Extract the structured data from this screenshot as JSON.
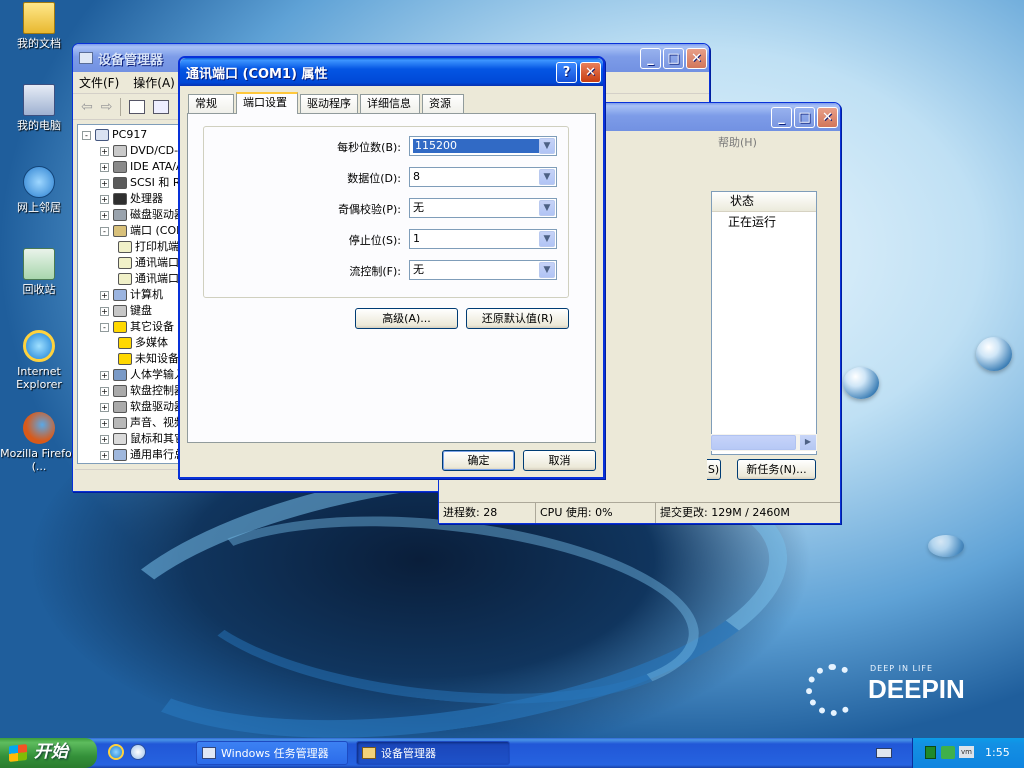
{
  "desktop": {
    "icons": [
      {
        "label": "我的文档",
        "icon": "my-documents-icon"
      },
      {
        "label": "我的电脑",
        "icon": "my-computer-icon"
      },
      {
        "label": "网上邻居",
        "icon": "network-places-icon"
      },
      {
        "label": "回收站",
        "icon": "recycle-bin-icon"
      },
      {
        "label": "Internet Explorer",
        "icon": "internet-explorer-icon"
      },
      {
        "label": "Mozilla Firefox (...",
        "icon": "firefox-icon"
      }
    ],
    "brand": {
      "tagline": "DEEP IN LIFE",
      "name": "DEEPIN"
    }
  },
  "device_manager": {
    "title": "设备管理器",
    "menu": [
      "文件(F)",
      "操作(A)"
    ],
    "tree": {
      "root": "PC917",
      "items": [
        {
          "label": "DVD/CD-ROM 驱动器",
          "expand": "+"
        },
        {
          "label": "IDE ATA/ATAPI 控制器",
          "expand": "+"
        },
        {
          "label": "SCSI 和 RAID 控制器",
          "expand": "+"
        },
        {
          "label": "处理器",
          "expand": "+"
        },
        {
          "label": "磁盘驱动器",
          "expand": "+"
        },
        {
          "label": "端口 (COM 和 LPT)",
          "expand": "-"
        },
        {
          "label": "打印机端口",
          "expand": "",
          "child": true
        },
        {
          "label": "通讯端口",
          "expand": "",
          "child": true
        },
        {
          "label": "通讯端口",
          "expand": "",
          "child": true
        },
        {
          "label": "计算机",
          "expand": "+"
        },
        {
          "label": "键盘",
          "expand": "+"
        },
        {
          "label": "其它设备",
          "expand": "-"
        },
        {
          "label": "多媒体",
          "expand": "",
          "child": true
        },
        {
          "label": "未知设备",
          "expand": "",
          "child": true
        },
        {
          "label": "人体学输入设备",
          "expand": "+"
        },
        {
          "label": "软盘控制器",
          "expand": "+"
        },
        {
          "label": "软盘驱动器",
          "expand": "+"
        },
        {
          "label": "声音、视频和游戏控制器",
          "expand": "+"
        },
        {
          "label": "鼠标和其它指针设备",
          "expand": "+"
        },
        {
          "label": "通用串行总线控制器",
          "expand": "+"
        }
      ]
    }
  },
  "task_manager": {
    "title": "Windows 任务管理器",
    "menu_help": "帮助(H)",
    "column_status": "状态",
    "row_status": "正在运行",
    "buttons": {
      "switch_partial": "S)",
      "new_task": "新任务(N)..."
    },
    "status_bar": {
      "processes": "进程数: 28",
      "cpu": "CPU 使用: 0%",
      "commit": "提交更改: 129M / 2460M"
    }
  },
  "dialog": {
    "title": "通讯端口 (COM1) 属性",
    "tabs": [
      "常规",
      "端口设置",
      "驱动程序",
      "详细信息",
      "资源"
    ],
    "selected_tab": 1,
    "fields": [
      {
        "label": "每秒位数(B):",
        "value": "115200",
        "highlighted": true
      },
      {
        "label": "数据位(D):",
        "value": "8"
      },
      {
        "label": "奇偶校验(P):",
        "value": "无"
      },
      {
        "label": "停止位(S):",
        "value": "1"
      },
      {
        "label": "流控制(F):",
        "value": "无"
      }
    ],
    "advanced_button": "高级(A)...",
    "restore_button": "还原默认值(R)",
    "ok_button": "确定",
    "cancel_button": "取消"
  },
  "taskbar": {
    "start_label": "开始",
    "tasks": [
      "Windows 任务管理器",
      "设备管理器"
    ],
    "clock": "1:55"
  },
  "colors": {
    "xp_blue": "#0054e3",
    "start_green": "#3c9d3c",
    "selection": "#316ac5"
  }
}
